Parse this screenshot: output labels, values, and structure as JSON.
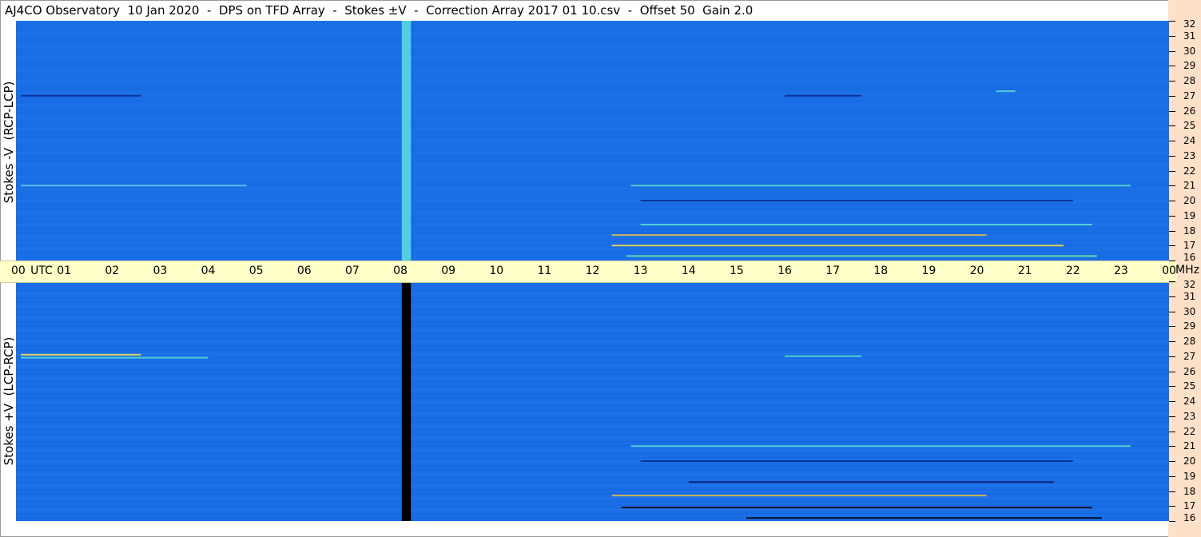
{
  "title": "AJ4CO Observatory  10 Jan 2020  -  DPS on TFD Array  -  Stokes ±V  -  Correction Array 2017 01 10.csv  -  Offset 50  Gain 2.0",
  "chart_data": [
    {
      "type": "heatmap",
      "panel": "top",
      "ylabel": "Stokes -V  (RCP-LCP)",
      "x_ticks": [
        "00",
        "01",
        "02",
        "03",
        "04",
        "05",
        "06",
        "07",
        "08",
        "09",
        "10",
        "11",
        "12",
        "13",
        "14",
        "15",
        "16",
        "17",
        "18",
        "19",
        "20",
        "21",
        "22",
        "23",
        "00"
      ],
      "x_unit_label": "UTC",
      "xlim_hours": [
        0,
        24
      ],
      "y_ticks": [
        16,
        17,
        18,
        19,
        20,
        21,
        22,
        23,
        24,
        25,
        26,
        27,
        28,
        29,
        30,
        31,
        32
      ],
      "y_unit_label": "MHz",
      "ylim_mhz": [
        16,
        32
      ],
      "background_color": "#1a6ee6",
      "calibration_band": {
        "start_hour": 8.03,
        "end_hour": 8.22,
        "color": "#4fd0e0"
      },
      "features": [
        {
          "start_hour": 0.1,
          "end_hour": 2.6,
          "mhz": 27.0,
          "color": "#0a2a8a"
        },
        {
          "start_hour": 12.4,
          "end_hour": 21.8,
          "mhz": 17.0,
          "color": "#ffe040"
        },
        {
          "start_hour": 12.4,
          "end_hour": 20.2,
          "mhz": 17.7,
          "color": "#f0c040"
        },
        {
          "start_hour": 13.0,
          "end_hour": 22.4,
          "mhz": 18.4,
          "color": "#5ee0d0"
        },
        {
          "start_hour": 12.7,
          "end_hour": 22.5,
          "mhz": 16.3,
          "color": "#70f0a0"
        },
        {
          "start_hour": 16.0,
          "end_hour": 17.6,
          "mhz": 27.0,
          "color": "#0a2a8a"
        },
        {
          "start_hour": 20.4,
          "end_hour": 20.8,
          "mhz": 27.3,
          "color": "#5ee0d0"
        },
        {
          "start_hour": 12.8,
          "end_hour": 23.2,
          "mhz": 21.0,
          "color": "#5ee0d0"
        },
        {
          "start_hour": 13.0,
          "end_hour": 22.0,
          "mhz": 20.0,
          "color": "#0a2a8a"
        },
        {
          "start_hour": 0.1,
          "end_hour": 4.8,
          "mhz": 21.0,
          "color": "#60d0e0"
        }
      ]
    },
    {
      "type": "heatmap",
      "panel": "bottom",
      "ylabel": "Stokes +V  (LCP-RCP)",
      "x_ticks": [
        "00",
        "01",
        "02",
        "03",
        "04",
        "05",
        "06",
        "07",
        "08",
        "09",
        "10",
        "11",
        "12",
        "13",
        "14",
        "15",
        "16",
        "17",
        "18",
        "19",
        "20",
        "21",
        "22",
        "23",
        "00"
      ],
      "x_unit_label": "UTC",
      "xlim_hours": [
        0,
        24
      ],
      "y_ticks": [
        16,
        17,
        18,
        19,
        20,
        21,
        22,
        23,
        24,
        25,
        26,
        27,
        28,
        29,
        30,
        31,
        32
      ],
      "y_unit_label": "MHz",
      "ylim_mhz": [
        16,
        32
      ],
      "background_color": "#1a6ee6",
      "calibration_band": {
        "start_hour": 8.03,
        "end_hour": 8.22,
        "color": "#000000"
      },
      "features": [
        {
          "start_hour": 0.1,
          "end_hour": 2.6,
          "mhz": 27.1,
          "color": "#ffe040"
        },
        {
          "start_hour": 0.1,
          "end_hour": 4.0,
          "mhz": 26.9,
          "color": "#5ee0d0"
        },
        {
          "start_hour": 12.6,
          "end_hour": 22.4,
          "mhz": 16.9,
          "color": "#000000"
        },
        {
          "start_hour": 12.4,
          "end_hour": 20.2,
          "mhz": 17.7,
          "color": "#f0c040"
        },
        {
          "start_hour": 14.0,
          "end_hour": 21.6,
          "mhz": 18.6,
          "color": "#0a1a60"
        },
        {
          "start_hour": 15.2,
          "end_hour": 22.6,
          "mhz": 16.2,
          "color": "#000000"
        },
        {
          "start_hour": 16.0,
          "end_hour": 17.6,
          "mhz": 27.0,
          "color": "#5ee0d0"
        },
        {
          "start_hour": 12.8,
          "end_hour": 23.2,
          "mhz": 21.0,
          "color": "#5ee0d0"
        },
        {
          "start_hour": 13.0,
          "end_hour": 22.0,
          "mhz": 20.0,
          "color": "#0a2a8a"
        }
      ]
    }
  ]
}
